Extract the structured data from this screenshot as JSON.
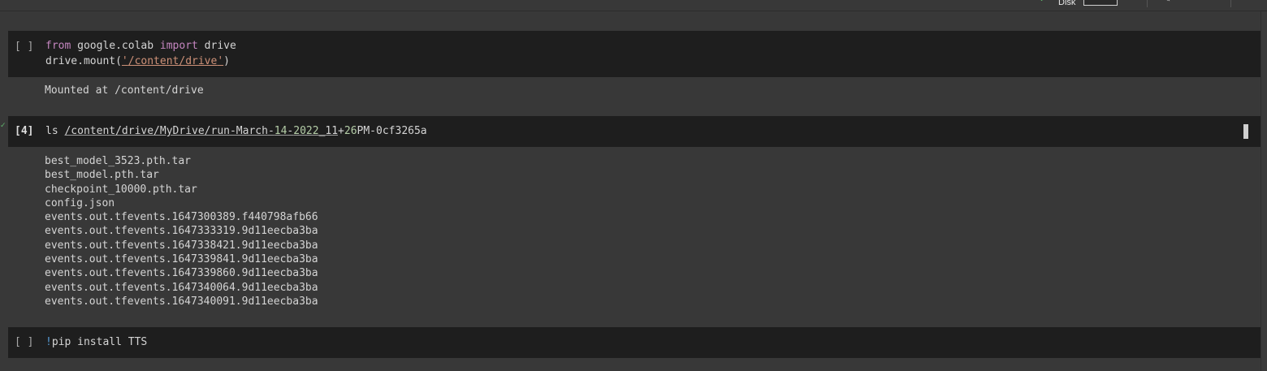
{
  "toolbar": {
    "disk_label": "Disk",
    "icons": [
      "check-icon",
      "edit-icon"
    ]
  },
  "cells": [
    {
      "prompt": "[ ]",
      "code": {
        "line1": {
          "kw_from": "from",
          "module": " google.colab ",
          "kw_import": "import",
          "name": " drive"
        },
        "line2": {
          "call": "drive.mount(",
          "quote_open": "'",
          "arg": "/content/drive",
          "quote_close": "'",
          "close": ")"
        }
      },
      "output": "Mounted at /content/drive"
    },
    {
      "prompt": "[4]",
      "code": {
        "cmd": "ls ",
        "path_a": "/content/drive/MyDrive/run-March",
        "dash1": "-",
        "n1": "14",
        "dash2": "-",
        "n2": "2022",
        "path_b": "_11",
        "plus": "+",
        "n3": "26",
        "path_c": "PM-0cf3265a"
      },
      "output_lines": [
        "best_model_3523.pth.tar",
        "best_model.pth.tar",
        "checkpoint_10000.pth.tar",
        "config.json",
        "events.out.tfevents.1647300389.f440798afb66",
        "events.out.tfevents.1647333319.9d11eecba3ba",
        "events.out.tfevents.1647338421.9d11eecba3ba",
        "events.out.tfevents.1647339841.9d11eecba3ba",
        "events.out.tfevents.1647339860.9d11eecba3ba",
        "events.out.tfevents.1647340064.9d11eecba3ba",
        "events.out.tfevents.1647340091.9d11eecba3ba"
      ]
    },
    {
      "prompt": "[ ]",
      "code": {
        "bang": "!",
        "cmd": "pip install TTS"
      }
    }
  ],
  "colors": {
    "background": "#383838",
    "cell_bg": "#1e1e1e",
    "keyword": "#c586c0",
    "string": "#ce9178",
    "number": "#b5cea8",
    "success": "#5fb36b"
  }
}
